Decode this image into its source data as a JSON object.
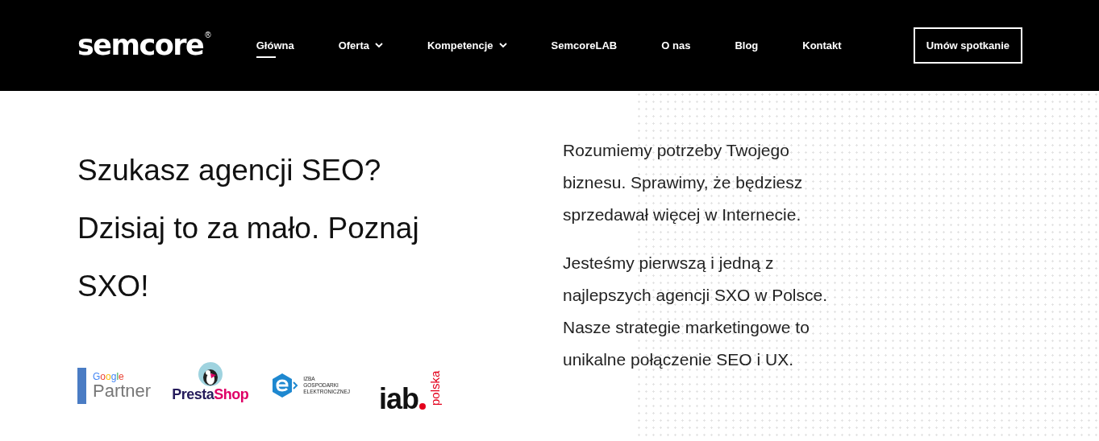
{
  "header": {
    "logo": "semcore",
    "logo_mark": "®",
    "nav": [
      {
        "label": "Główna",
        "selected": true,
        "dropdown": false
      },
      {
        "label": "Oferta",
        "selected": false,
        "dropdown": true
      },
      {
        "label": "Kompetencje",
        "selected": false,
        "dropdown": true
      },
      {
        "label": "SemcoreLAB",
        "selected": false,
        "dropdown": false
      },
      {
        "label": "O nas",
        "selected": false,
        "dropdown": false
      },
      {
        "label": "Blog",
        "selected": false,
        "dropdown": false
      },
      {
        "label": "Kontakt",
        "selected": false,
        "dropdown": false
      }
    ],
    "cta": "Umów spotkanie"
  },
  "hero": {
    "heading": "Szukasz agencji SEO? Dzisiaj to za mało. Poznaj SXO!",
    "partners": [
      {
        "kind": "google",
        "lines": [
          "Google",
          "Partner"
        ]
      },
      {
        "kind": "prestashop",
        "lines": [
          "Presta",
          "Shop"
        ]
      },
      {
        "kind": "izba",
        "lines": [
          "IZBA",
          "GOSPODARKI",
          "ELEKTRONICZNEJ"
        ]
      },
      {
        "kind": "iab",
        "lines": [
          "iab",
          "polska"
        ]
      }
    ],
    "paragraphs": [
      "Rozumiemy potrzeby Twojego biznesu. Sprawimy, że będziesz sprzedawał więcej w Internecie.",
      "Jesteśmy pierwszą i jedną z najlepszych agencji SXO w Polsce. Nasze strategie marketingowe to unikalne połączenie SEO i UX."
    ]
  }
}
